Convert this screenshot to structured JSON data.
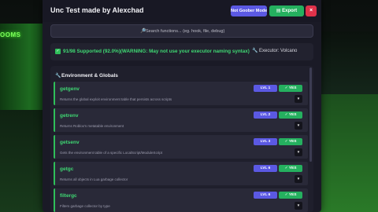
{
  "background": {
    "sign_text": "OOMS"
  },
  "window": {
    "title": "Unc Test made by Alexchad",
    "buttons": {
      "goober": "Not Goober Mode",
      "export_icon": "export-icon",
      "export": "Export",
      "close": "×"
    }
  },
  "search": {
    "icon": "🔎",
    "placeholder": "Search functions... (eg. hook, file, debug)",
    "value": ""
  },
  "status": {
    "check_icon": "✓",
    "text": "91/98 Supported (92.0%)(WARNING: May not use your executor naming syntax)",
    "executor_icon": "🔧",
    "executor_text": "Executor: Volcano"
  },
  "section": {
    "icon": "🔧",
    "title": "Environment & Globals"
  },
  "functions": [
    {
      "name": "getgenv",
      "desc": "Returns the global exploit environment table that persists across scripts",
      "level": "LVL 1",
      "status": "✓ YES",
      "expand": "▼"
    },
    {
      "name": "getrenv",
      "desc": "Returns Roblox's metatable environment",
      "level": "LVL 2",
      "status": "✓ YES",
      "expand": "▼"
    },
    {
      "name": "getsenv",
      "desc": "Gets the environment table of a specific LocalScript/ModuleScript",
      "level": "LVL 3",
      "status": "✓ YES",
      "expand": "▼"
    },
    {
      "name": "getgc",
      "desc": "Returns all objects in Lua garbage collector",
      "level": "LVL 6",
      "status": "✓ YES",
      "expand": "▼"
    },
    {
      "name": "filtergc",
      "desc": "Filters garbage collector by type",
      "level": "LVL 6",
      "status": "✓ YES",
      "expand": "▼"
    }
  ],
  "colors": {
    "accent_green": "#3fd873",
    "level_purple": "#5b59e3",
    "yes_green": "#25b05f",
    "close_red": "#e0324a"
  }
}
